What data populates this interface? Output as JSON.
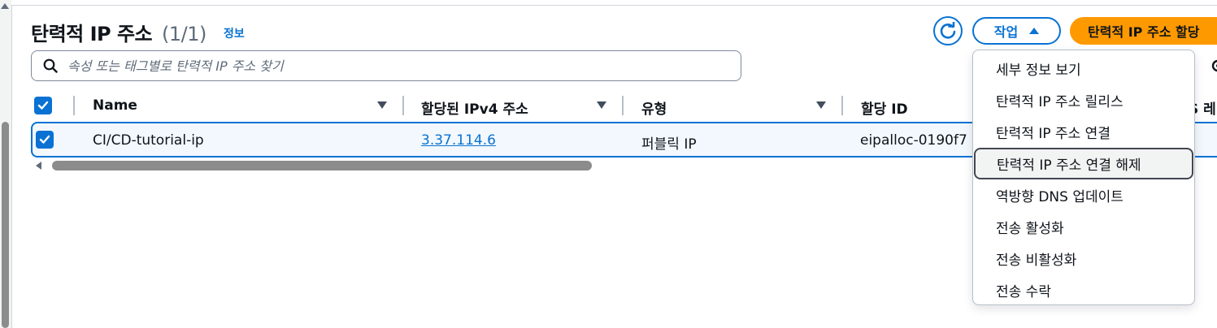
{
  "header": {
    "title": "탄력적 IP 주소",
    "count": "(1/1)",
    "info_link": "정보",
    "actions_label": "작업",
    "allocate_label": "탄력적 IP 주소 할당"
  },
  "search": {
    "placeholder": "속성 또는 태그별로 탄력적 IP 주소 찾기",
    "value": ""
  },
  "table": {
    "columns": [
      "Name",
      "할당된 IPv4 주소",
      "유형",
      "할당 ID",
      "S 레"
    ],
    "rows": [
      {
        "selected": true,
        "name": "CI/CD-tutorial-ip",
        "ipv4": "3.37.114.6",
        "type": "퍼블릭 IP",
        "allocation_id": "eipalloc-0190f7"
      }
    ]
  },
  "actions_menu": {
    "items": [
      "세부 정보 보기",
      "탄력적 IP 주소 릴리스",
      "탄력적 IP 주소 연결",
      "탄력적 IP 주소 연결 해제",
      "역방향 DNS 업데이트",
      "전송 활성화",
      "전송 비활성화",
      "전송 수락"
    ],
    "focused_index": 3
  },
  "colors": {
    "accent": "#0972d3",
    "primary_button": "#ff9900",
    "text": "#0f141a",
    "muted": "#5f6b7a"
  }
}
